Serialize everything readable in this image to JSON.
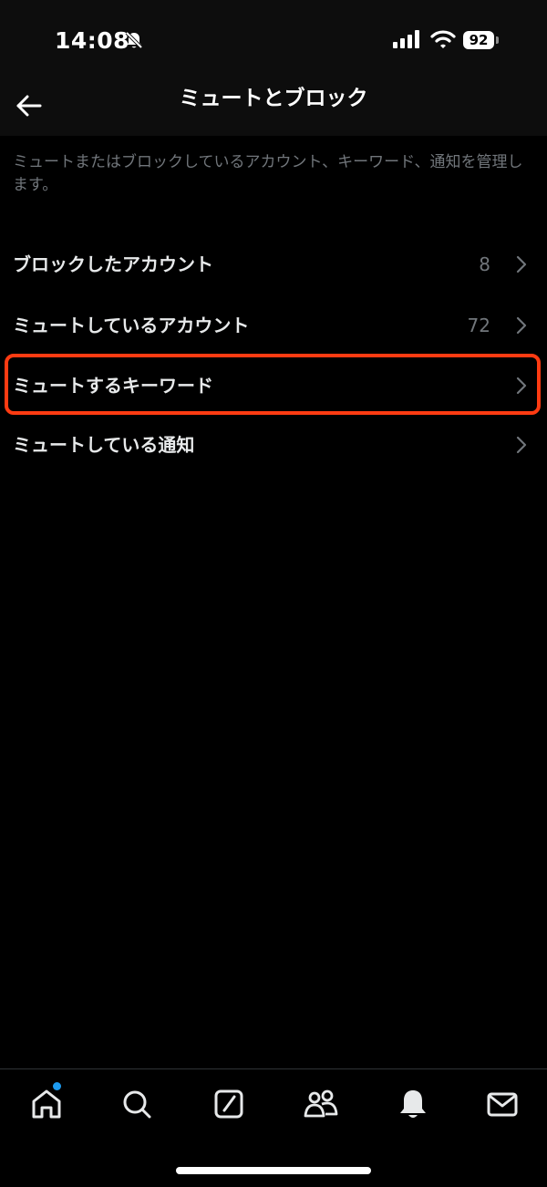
{
  "status_bar": {
    "time": "14:08",
    "battery": "92",
    "icons": [
      "bell-off-icon",
      "signal-icon",
      "wifi-icon",
      "battery-icon"
    ]
  },
  "header": {
    "title": "ミュートとブロック",
    "back_icon": "arrow-left-icon"
  },
  "description": "ミュートまたはブロックしているアカウント、キーワード、通知を管理します。",
  "menu": {
    "items": [
      {
        "label": "ブロックしたアカウント",
        "count": "8"
      },
      {
        "label": "ミュートしているアカウント",
        "count": "72"
      },
      {
        "label": "ミュートするキーワード",
        "count": ""
      },
      {
        "label": "ミュートしている通知",
        "count": ""
      }
    ]
  },
  "colors": {
    "background": "#000000",
    "header_background": "#0d0d0d",
    "text_primary": "#e7e9ea",
    "text_secondary": "#71767b",
    "highlight_border": "#ff3b12",
    "notification_dot": "#1d9bf0"
  },
  "tab_bar": {
    "tabs": [
      "home-icon",
      "search-icon",
      "compose-icon",
      "communities-icon",
      "notifications-icon",
      "messages-icon"
    ],
    "home_has_badge": true
  }
}
